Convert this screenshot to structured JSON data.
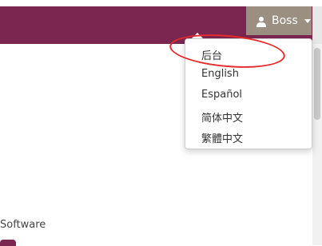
{
  "user_menu": {
    "username": "Boss",
    "items": [
      "后台",
      "English",
      "Español",
      "简体中文",
      "繁體中文"
    ]
  },
  "footer": {
    "text": "Software"
  },
  "colors": {
    "navbar": "#7b2651",
    "user_button": "#9a8f80",
    "highlight_circle": "#e52b2b"
  }
}
